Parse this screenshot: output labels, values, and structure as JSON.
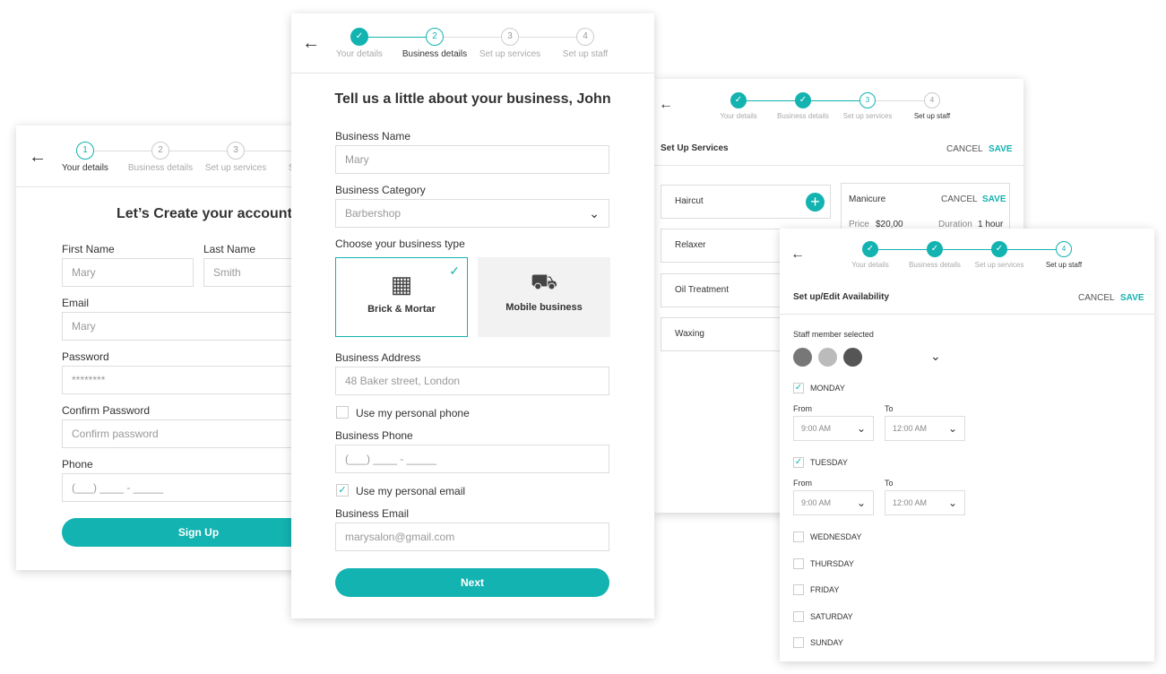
{
  "colors": {
    "accent": "#12b3b0"
  },
  "steps": [
    "Your details",
    "Business details",
    "Set up services",
    "Set up staff"
  ],
  "account": {
    "title": "Let’s Create your account",
    "first_name_label": "First Name",
    "first_name_value": "Mary",
    "last_name_label": "Last Name",
    "last_name_value": "Smith",
    "email_label": "Email",
    "email_value": "Mary",
    "password_label": "Password",
    "password_value": "********",
    "confirm_label": "Confirm Password",
    "confirm_placeholder": "Confirm password",
    "phone_label": "Phone",
    "phone_placeholder": "(___) ____ - _____",
    "signup": "Sign Up"
  },
  "business": {
    "title": "Tell us a little about your business, John",
    "name_label": "Business Name",
    "name_value": "Mary",
    "category_label": "Business Category",
    "category_value": "Barbershop",
    "type_label": "Choose your business type",
    "type_brick": "Brick & Mortar",
    "type_mobile": "Mobile business",
    "address_label": "Business Address",
    "address_value": "48 Baker street, London",
    "personal_phone": "Use my personal phone",
    "phone_label": "Business Phone",
    "phone_placeholder": "(___) ____ - _____",
    "personal_email": "Use my personal email",
    "email_label": "Business Email",
    "email_value": "marysalon@gmail.com",
    "next": "Next"
  },
  "services": {
    "title": "Set Up Services",
    "cancel": "CANCEL",
    "save": "SAVE",
    "items": [
      "Haircut",
      "Relaxer",
      "Oil Treatment",
      "Waxing"
    ],
    "detail": {
      "name": "Manicure",
      "cancel": "CANCEL",
      "save": "SAVE",
      "price_label": "Price",
      "price": "$20,00",
      "duration_label": "Duration",
      "duration": "1 hour"
    }
  },
  "staff": {
    "title": "Set up/Edit Availability",
    "cancel": "CANCEL",
    "save": "SAVE",
    "staff_label": "Staff member selected",
    "from": "From",
    "to": "To",
    "days": [
      {
        "name": "MONDAY",
        "checked": true,
        "from": "9:00 AM",
        "to": "12:00 AM"
      },
      {
        "name": "TUESDAY",
        "checked": true,
        "from": "9:00 AM",
        "to": "12:00 AM"
      },
      {
        "name": "WEDNESDAY",
        "checked": false
      },
      {
        "name": "THURSDAY",
        "checked": false
      },
      {
        "name": "FRIDAY",
        "checked": false
      },
      {
        "name": "SATURDAY",
        "checked": false
      },
      {
        "name": "SUNDAY",
        "checked": false
      }
    ]
  }
}
